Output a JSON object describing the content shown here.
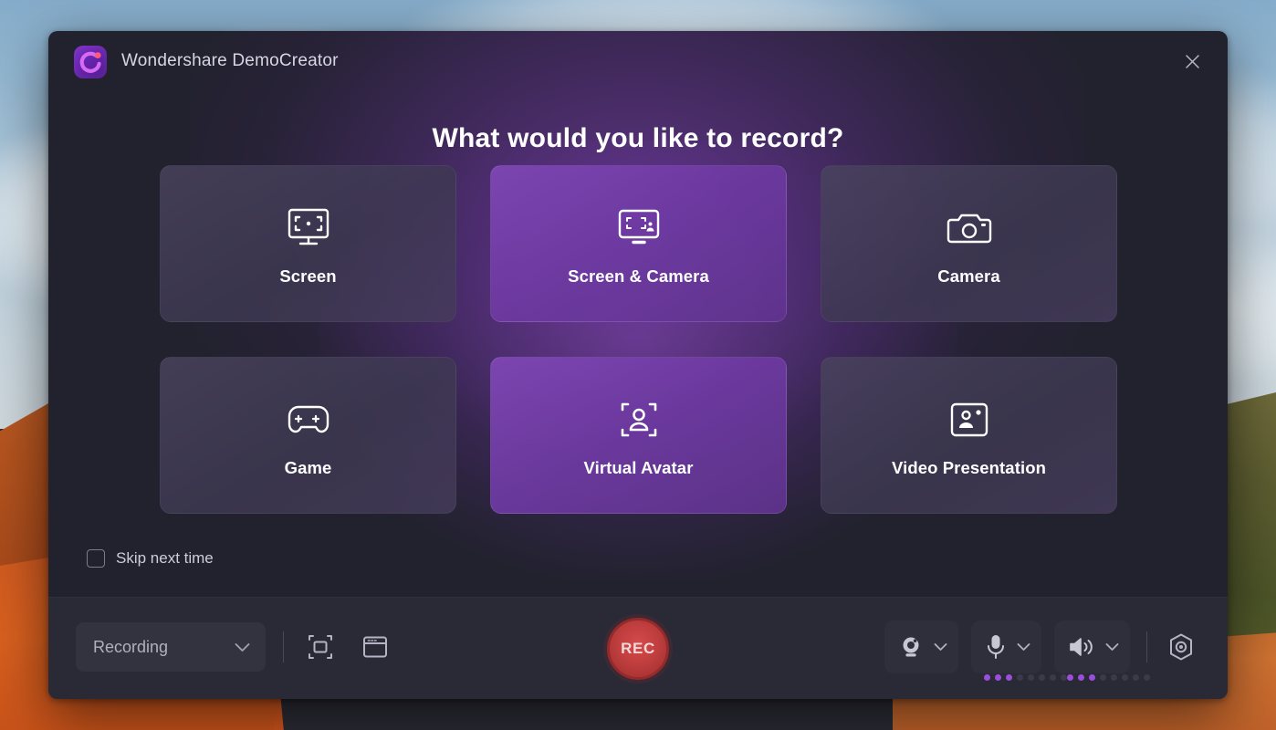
{
  "window": {
    "app_title": "Wondershare DemoCreator",
    "logo_icon": "democreator-logo-icon",
    "close_icon": "close-icon",
    "heading": "What would you like to record?",
    "accent_purple": "#8a42c4",
    "panel_bg": "#22222e",
    "toolbar_bg": "#2a2a36"
  },
  "cards": [
    {
      "label": "Screen",
      "icon": "monitor-capture-icon",
      "highlight": false
    },
    {
      "label": "Screen & Camera",
      "icon": "monitor-camera-icon",
      "highlight": true
    },
    {
      "label": "Camera",
      "icon": "camera-icon",
      "highlight": false
    },
    {
      "label": "Game",
      "icon": "gamepad-icon",
      "highlight": false
    },
    {
      "label": "Virtual Avatar",
      "icon": "avatar-frame-icon",
      "highlight": true
    },
    {
      "label": "Video Presentation",
      "icon": "presenter-card-icon",
      "highlight": false
    }
  ],
  "skip": {
    "label": "Skip next time",
    "checked": false,
    "checkbox_icon": "checkbox-unchecked-icon"
  },
  "toolbar": {
    "mode_select": {
      "value": "Recording",
      "chevron_icon": "chevron-down-icon"
    },
    "capture_buttons": [
      {
        "name": "fullscreen-capture-icon"
      },
      {
        "name": "window-capture-icon"
      }
    ],
    "record_button": {
      "label": "REC",
      "color": "#c23f3f",
      "ring_color": "#962a2a"
    },
    "devices": [
      {
        "name": "webcam",
        "icon": "webcam-icon",
        "chevron_icon": "chevron-down-icon",
        "has_level": false,
        "level_on": 0,
        "level_total": 0
      },
      {
        "name": "microphone",
        "icon": "microphone-icon",
        "chevron_icon": "chevron-down-icon",
        "has_level": true,
        "level_on": 3,
        "level_total": 8
      },
      {
        "name": "speaker",
        "icon": "speaker-icon",
        "chevron_icon": "chevron-down-icon",
        "has_level": true,
        "level_on": 3,
        "level_total": 8
      }
    ],
    "settings": {
      "icon": "settings-hex-icon"
    },
    "level_active_color": "#9a4edb"
  }
}
